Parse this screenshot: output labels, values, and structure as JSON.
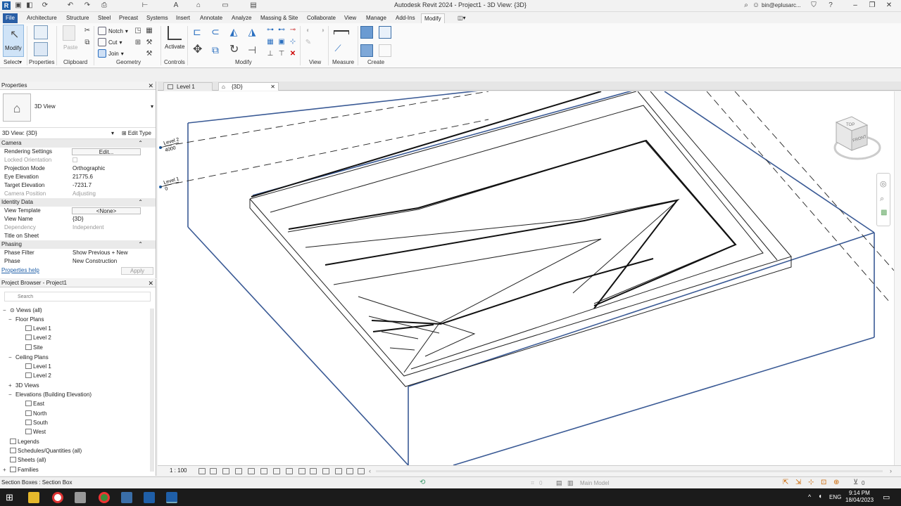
{
  "window": {
    "title": "Autodesk Revit 2024 - Project1 - 3D View: {3D}",
    "user": "bin@eplusarc..."
  },
  "ribbon": {
    "tabs": [
      "File",
      "Architecture",
      "Structure",
      "Steel",
      "Precast",
      "Systems",
      "Insert",
      "Annotate",
      "Analyze",
      "Massing & Site",
      "Collaborate",
      "View",
      "Manage",
      "Add-Ins",
      "Modify"
    ],
    "active_tab": "Modify",
    "panels": {
      "select": "Select",
      "properties": "Properties",
      "clipboard": "Clipboard",
      "geometry": "Geometry",
      "controls": "Controls",
      "modify": "Modify",
      "view": "View",
      "measure": "Measure",
      "create": "Create"
    },
    "buttons": {
      "modify": "Modify",
      "paste": "Paste",
      "notch": "Notch",
      "cut": "Cut",
      "join": "Join",
      "activate": "Activate"
    }
  },
  "properties": {
    "title": "Properties",
    "type_name": "3D View",
    "instance_selector": "3D View: {3D}",
    "edit_type": "Edit Type",
    "groups": {
      "camera": "Camera",
      "identity": "Identity Data",
      "phasing": "Phasing"
    },
    "rows": {
      "rendering_settings": {
        "name": "Rendering Settings",
        "value": "Edit..."
      },
      "locked_orientation": {
        "name": "Locked Orientation",
        "value": ""
      },
      "projection_mode": {
        "name": "Projection Mode",
        "value": "Orthographic"
      },
      "eye_elevation": {
        "name": "Eye Elevation",
        "value": "21775.6"
      },
      "target_elevation": {
        "name": "Target Elevation",
        "value": "-7231.7"
      },
      "camera_position": {
        "name": "Camera Position",
        "value": "Adjusting"
      },
      "view_template": {
        "name": "View Template",
        "value": "<None>"
      },
      "view_name": {
        "name": "View Name",
        "value": "{3D}"
      },
      "dependency": {
        "name": "Dependency",
        "value": "Independent"
      },
      "title_on_sheet": {
        "name": "Title on Sheet",
        "value": ""
      },
      "phase_filter": {
        "name": "Phase Filter",
        "value": "Show Previous + New"
      },
      "phase": {
        "name": "Phase",
        "value": "New Construction"
      }
    },
    "help": "Properties help",
    "apply": "Apply"
  },
  "browser": {
    "title": "Project Browser - Project1",
    "search_placeholder": "Search",
    "views_all": "Views (all)",
    "floor_plans": "Floor Plans",
    "fp_level1": "Level 1",
    "fp_level2": "Level 2",
    "fp_site": "Site",
    "ceiling_plans": "Ceiling Plans",
    "cp_level1": "Level 1",
    "cp_level2": "Level 2",
    "views_3d": "3D Views",
    "elevations": "Elevations (Building Elevation)",
    "el_east": "East",
    "el_north": "North",
    "el_south": "South",
    "el_west": "West",
    "legends": "Legends",
    "schedules": "Schedules/Quantities (all)",
    "sheets": "Sheets (all)",
    "families": "Families"
  },
  "view_tabs": [
    {
      "label": "Level 1"
    },
    {
      "label": "{3D}"
    }
  ],
  "canvas": {
    "level2_name": "Level 2",
    "level2_elev": "4000",
    "level1_name": "Level 1",
    "level1_elev": "0",
    "viewcube_top": "TOP",
    "viewcube_front": "FRONT"
  },
  "view_control": {
    "scale": "1 : 100"
  },
  "status": {
    "text": "Section Boxes : Section Box",
    "model": "Main Model",
    "filter_count": "0",
    "select_count": "0"
  },
  "taskbar": {
    "lang": "ENG",
    "time": "9:14 PM",
    "date": "18/04/2023"
  }
}
